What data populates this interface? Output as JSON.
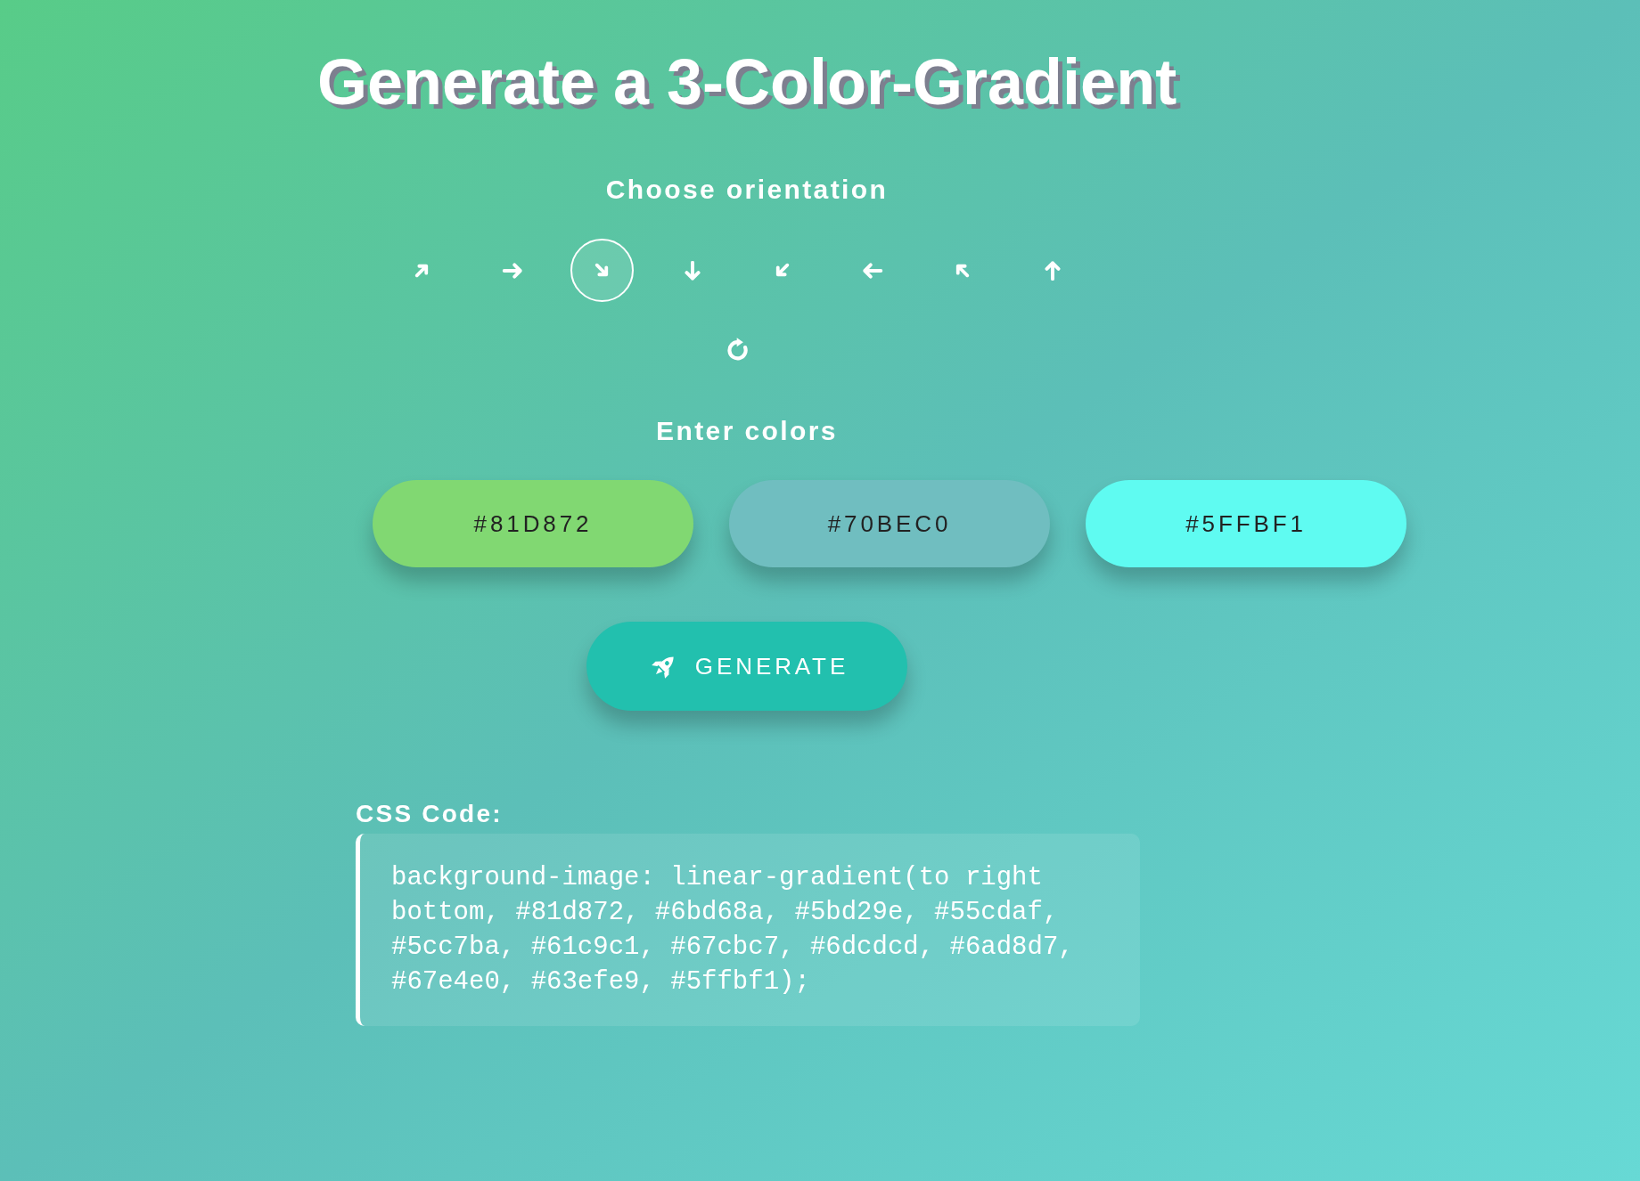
{
  "title": "Generate a 3-Color-Gradient",
  "orientation": {
    "heading": "Choose orientation",
    "options": [
      {
        "selected": false
      },
      {
        "selected": false
      },
      {
        "selected": true
      },
      {
        "selected": false
      },
      {
        "selected": false
      },
      {
        "selected": false
      },
      {
        "selected": false
      },
      {
        "selected": false
      }
    ]
  },
  "colors": {
    "heading": "Enter colors",
    "inputs": [
      {
        "value": "#81D872",
        "color": "#81d872"
      },
      {
        "value": "#70BEC0",
        "color": "#70bec0"
      },
      {
        "value": "#5FFBF1",
        "color": "#5ffbf1"
      }
    ]
  },
  "generate_button": {
    "label": "GENERATE"
  },
  "css_code": {
    "heading": "CSS Code:",
    "code": "background-image: linear-gradient(to right bottom, #81d872, #6bd68a, #5bd29e, #55cdaf, #5cc7ba, #61c9c1, #67cbc7, #6dcdcd, #6ad8d7, #67e4e0, #63efe9, #5ffbf1);"
  }
}
